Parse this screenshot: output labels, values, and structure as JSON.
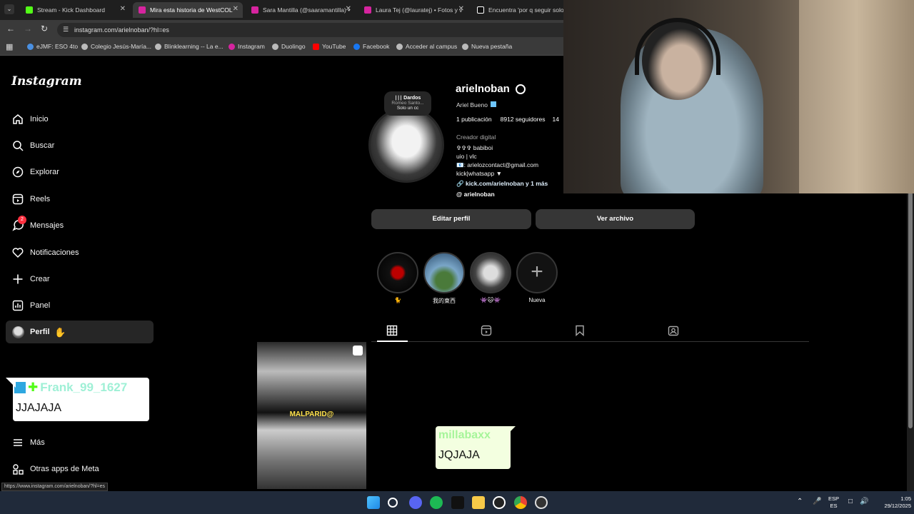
{
  "browser": {
    "tabs": [
      {
        "label": "Stream - Kick Dashboard",
        "color": "#53fc18"
      },
      {
        "label": "Mira esta historia de WestCOL",
        "color": "#d6249f"
      },
      {
        "label": "Sara Mantilla (@saaramantilla) •",
        "color": "#d6249f"
      },
      {
        "label": "Laura Tej (@lauratej) • Fotos y v",
        "color": "#d6249f"
      },
      {
        "label": "Encuentra 'por q seguir solo m",
        "color": "#ffffff"
      }
    ],
    "url": "instagram.com/arielnoban/?hl=es",
    "bookmarks": [
      {
        "label": "eJMF: ESO 4to"
      },
      {
        "label": "Colegio Jesús-María..."
      },
      {
        "label": "Blinklearning -- La e..."
      },
      {
        "label": "Instagram"
      },
      {
        "label": "Duolingo"
      },
      {
        "label": "YouTube"
      },
      {
        "label": "Facebook"
      },
      {
        "label": "Acceder al campus"
      },
      {
        "label": "Nueva pestaña"
      }
    ],
    "status_url": "https://www.instagram.com/arielnoban/?hl=es"
  },
  "sidebar": {
    "logo": "Instagram",
    "items": [
      {
        "label": "Inicio",
        "icon": "home-icon"
      },
      {
        "label": "Buscar",
        "icon": "search-icon"
      },
      {
        "label": "Explorar",
        "icon": "compass-icon"
      },
      {
        "label": "Reels",
        "icon": "reels-icon"
      },
      {
        "label": "Mensajes",
        "icon": "messenger-icon",
        "badge": "2"
      },
      {
        "label": "Notificaciones",
        "icon": "heart-icon"
      },
      {
        "label": "Crear",
        "icon": "plus-icon"
      },
      {
        "label": "Panel",
        "icon": "chart-icon"
      },
      {
        "label": "Perfil",
        "icon": "avatar-icon"
      }
    ],
    "more": "Más",
    "meta": "Otras apps de Meta"
  },
  "profile": {
    "note_title": "Dardos",
    "note_line2": "Romeo Santo...",
    "note_line3": "Solo un cc",
    "username": "arielnoban",
    "name": "Ariel Bueno",
    "posts": "1 publicación",
    "followers": "8912 seguidores",
    "following_partial": "14",
    "category": "Creador digital",
    "bio_lines": [
      "✞✞✞ babiboi",
      "uio | vlc",
      "📧: arielozcontact@gmail.com",
      "kick|whatsapp ▼"
    ],
    "link": "kick.com/arielnoban y 1 más",
    "threads": "arielnoban",
    "edit_btn": "Editar perfil",
    "archive_btn": "Ver archivo",
    "highlights": [
      {
        "label": "🐈"
      },
      {
        "label": "我的東西"
      },
      {
        "label": "👾🐱👾"
      },
      {
        "label": "Nueva"
      }
    ]
  },
  "post": {
    "caption": "MALPARID@"
  },
  "overlays": {
    "chat1_user": "Frank_99_1627",
    "chat1_msg": "JJAJAJA",
    "chat2_user": "millabaxx",
    "chat2_msg": "JQJAJA"
  },
  "taskbar": {
    "lang1": "ESP",
    "lang2": "ES",
    "time": "1:05",
    "date": "29/12/2025"
  }
}
